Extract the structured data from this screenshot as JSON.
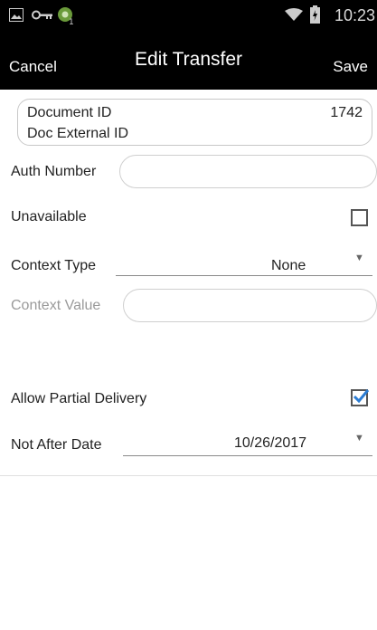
{
  "status_bar": {
    "time": "10:23",
    "icons": [
      "image-icon",
      "key-icon",
      "android-notification-icon",
      "wifi-icon",
      "battery-icon"
    ]
  },
  "action_bar": {
    "cancel_label": "Cancel",
    "title": "Edit Transfer",
    "save_label": "Save"
  },
  "document": {
    "id_label": "Document ID",
    "id_value": "1742",
    "external_id_label": "Doc External ID"
  },
  "auth_number": {
    "label": "Auth Number",
    "value": ""
  },
  "unavailable": {
    "label": "Unavailable",
    "checked": false
  },
  "context_type": {
    "label": "Context Type",
    "value": "None"
  },
  "context_value": {
    "label": "Context Value",
    "value": ""
  },
  "allow_partial_delivery": {
    "label": "Allow Partial Delivery",
    "checked": true
  },
  "not_after_date": {
    "label": "Not After Date",
    "value": "10/26/2017"
  },
  "colors": {
    "accent": "#2b7cd3",
    "background": "#ffffff",
    "bar": "#000000"
  }
}
